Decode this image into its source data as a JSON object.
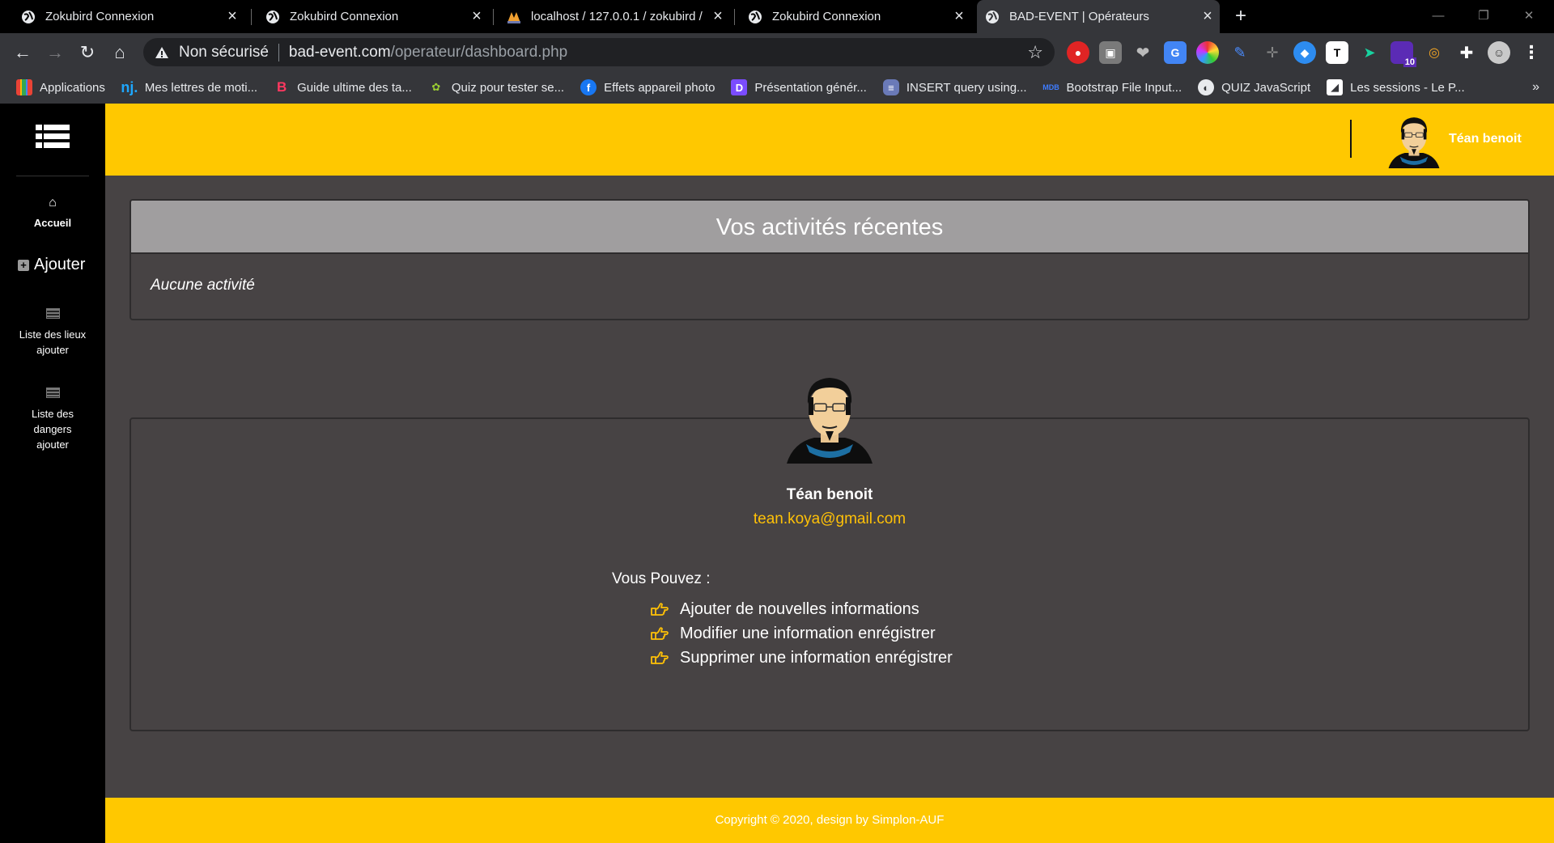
{
  "browser": {
    "tabs": [
      {
        "title": "Zokubird Connexion",
        "icon": "globe-icon"
      },
      {
        "title": "Zokubird Connexion",
        "icon": "globe-icon"
      },
      {
        "title": "localhost / 127.0.0.1 / zokubird / ",
        "icon": "phpmyadmin-icon"
      },
      {
        "title": "Zokubird Connexion",
        "icon": "globe-icon"
      },
      {
        "title": "BAD-EVENT | Opérateurs",
        "icon": "globe-icon"
      }
    ],
    "address": {
      "security_label": "Non sécurisé",
      "host": "bad-event.com",
      "path": "/operateur/dashboard.php"
    },
    "extension_badge": "10",
    "bookmarks": [
      {
        "label": "Applications",
        "icon": "apps-grid-icon"
      },
      {
        "label": "Mes lettres de moti...",
        "icon": "nj-icon"
      },
      {
        "label": "Guide ultime des ta...",
        "icon": "b-logo-icon"
      },
      {
        "label": "Quiz pour tester se...",
        "icon": "quiz-icon"
      },
      {
        "label": "Effets appareil photo",
        "icon": "facebook-icon"
      },
      {
        "label": "Présentation génér...",
        "icon": "d-logo-icon"
      },
      {
        "label": "INSERT query using...",
        "icon": "db-icon"
      },
      {
        "label": "Bootstrap File Input...",
        "icon": "mdb-icon"
      },
      {
        "label": "QUIZ JavaScript",
        "icon": "globe-icon"
      },
      {
        "label": "Les sessions - Le P...",
        "icon": "openclassrooms-icon"
      }
    ],
    "bookmarks_more": "»"
  },
  "sidebar": {
    "items": [
      {
        "label": "Accueil",
        "icon": "home-icon"
      },
      {
        "label": "Ajouter",
        "icon": "plus-square-icon"
      },
      {
        "label_lines": [
          "Liste des lieux",
          "ajouter"
        ],
        "icon": "list-icon"
      },
      {
        "label_lines": [
          "Liste des",
          "dangers",
          "ajouter"
        ],
        "icon": "list-icon"
      }
    ]
  },
  "header": {
    "user_name": "Téan benoit"
  },
  "activities": {
    "title": "Vos activités récentes",
    "empty_text": "Aucune activité"
  },
  "profile": {
    "name": "Téan benoit",
    "email": "tean.koya@gmail.com",
    "can_title": "Vous Pouvez :",
    "can_items": [
      "Ajouter de nouvelles informations",
      "Modifier une information enrégistrer",
      "Supprimer une information enrégistrer"
    ]
  },
  "footer": {
    "text": "Copyright © 2020, design by Simplon-AUF"
  },
  "colors": {
    "accent": "#ffc800",
    "link": "#ffc107",
    "page_bg": "#474344",
    "sidebar_bg": "#000000"
  }
}
